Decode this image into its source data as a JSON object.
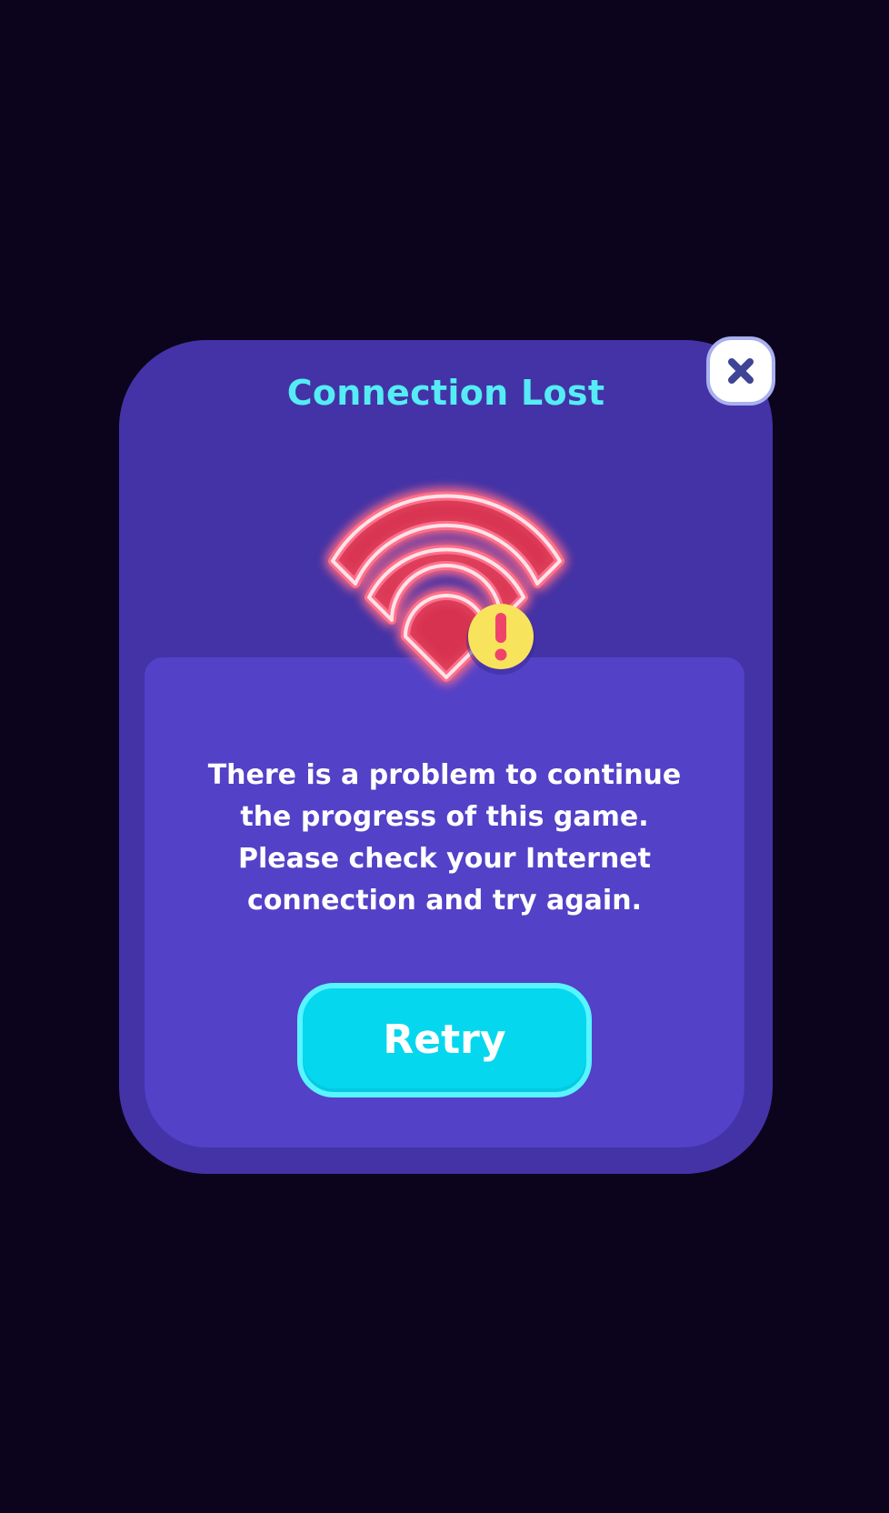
{
  "dialog": {
    "title": "Connection Lost",
    "message_lines": [
      "There is a problem to continue",
      "the progress of this game.",
      "Please check your Internet",
      "connection and try again."
    ],
    "retry_label": "Retry",
    "icon": "wifi-warning-icon",
    "close_icon": "close-icon"
  },
  "colors": {
    "background": "#0c041c",
    "dialog": "#4333a6",
    "panel": "#5341c8",
    "title": "#55ecf6",
    "button": "#05d7ee",
    "wifi_glow": "#ff3c64",
    "warning_badge": "#f8e45c",
    "close_x": "#3f4596"
  }
}
